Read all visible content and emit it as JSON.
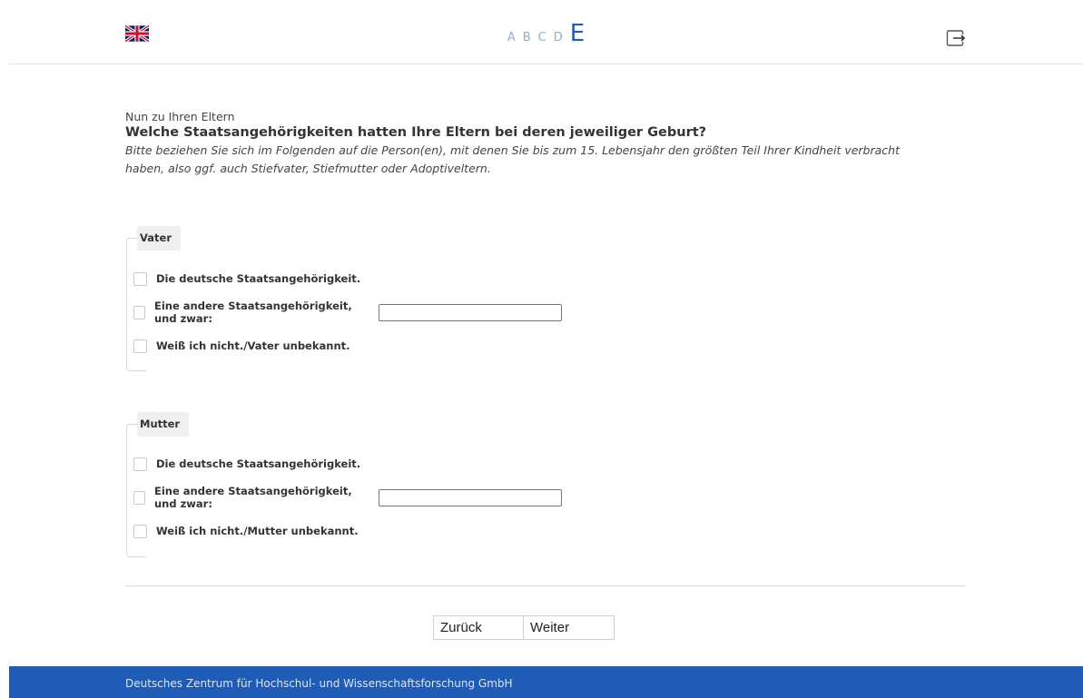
{
  "header": {
    "language_icon": "uk-flag-icon",
    "sections": [
      "A",
      "B",
      "C",
      "D"
    ],
    "active_section": "E",
    "logout_icon": "logout-icon"
  },
  "intro": {
    "pre": "Nun zu Ihren Eltern",
    "question": "Welche Staatsangehörigkeiten hatten Ihre Eltern bei deren jeweiliger Geburt?",
    "hint": "Bitte beziehen Sie sich im Folgenden auf die Person(en), mit denen Sie bis zum 15. Lebensjahr den größten Teil Ihrer Kindheit verbracht haben, also ggf. auch Stiefvater, Stiefmutter oder Adoptiveltern."
  },
  "father": {
    "legend": "Vater",
    "opt_german": "Die deutsche Staatsangehörigkeit.",
    "opt_other": "Eine andere Staatsangehörigkeit, und zwar:",
    "other_value": "",
    "opt_unknown": "Weiß ich nicht./Vater unbekannt."
  },
  "mother": {
    "legend": "Mutter",
    "opt_german": "Die deutsche Staatsangehörigkeit.",
    "opt_other": "Eine andere Staatsangehörigkeit, und zwar:",
    "other_value": "",
    "opt_unknown": "Weiß ich nicht./Mutter unbekannt."
  },
  "navigation": {
    "back": "Zurück",
    "next": "Weiter"
  },
  "footer": {
    "text": "Deutsches Zentrum für Hochschul- und Wissenschaftsforschung GmbH"
  },
  "colors": {
    "accent": "#1f5cb8",
    "section_inactive": "#8fb1d6"
  }
}
